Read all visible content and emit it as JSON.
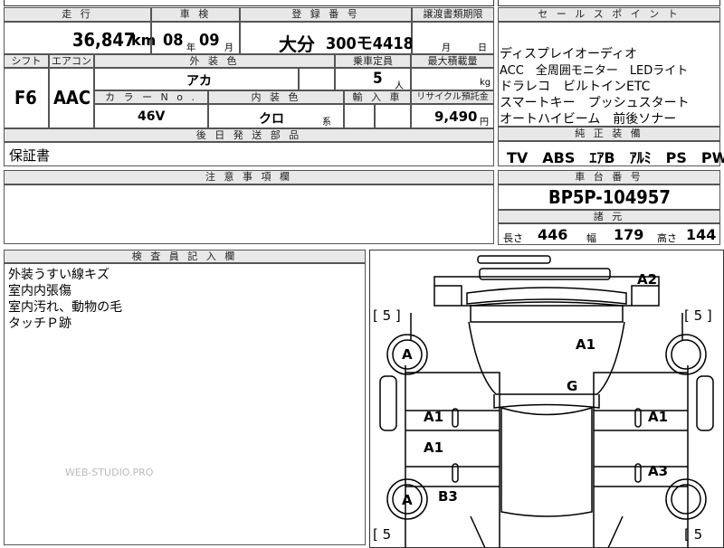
{
  "header": {
    "mileage_label": "走 行",
    "inspection_label": "車 検",
    "registration_label": "登 録 番 号",
    "transfer_label": "譲渡書類期限",
    "selling_points_label": "セ ー ル ス ポ イ ン ト"
  },
  "mileage": {
    "value": "36,847",
    "unit": "km"
  },
  "inspection": {
    "year": "08",
    "year_unit": "年",
    "month": "09",
    "month_unit": "月"
  },
  "registration": {
    "region": "大分",
    "number": "300モ4418"
  },
  "transfer": {
    "month_unit": "月",
    "day_unit": "日"
  },
  "specs": {
    "shift_label": "シフト",
    "shift": "F6",
    "ac_label": "エアコン",
    "ac": "AAC",
    "exterior_label": "外 装 色",
    "exterior": "アカ",
    "seats_label": "乗車定員",
    "seats": "5",
    "seats_unit": "人",
    "load_label": "最大積載量",
    "load_unit": "kg",
    "color_no_label": "カ ラ ー N o .",
    "color_no": "46V",
    "interior_label": "内 装 色",
    "interior": "クロ",
    "interior_unit": "系",
    "import_label": "輸 入 車",
    "recycle_label": "リサイクル預託金",
    "recycle": "9,490",
    "recycle_unit": "円"
  },
  "selling_points": [
    "ディスプレイオーディオ",
    "ACC　全周囲モニター　LEDライト",
    "ドラレコ　ビルトインETC",
    "スマートキー　プッシュスタート",
    "オートハイビーム　前後ソナー"
  ],
  "later_parts": {
    "label": "後 日 発 送 部 品",
    "value": "保証書"
  },
  "equipment": {
    "label": "純 正 装 備",
    "value": "TV　ABS　ｴｱB　ｱﾙﾐ　PS　PW"
  },
  "notes": {
    "label": "注 意 事 項 欄"
  },
  "chassis": {
    "label": "車 台 番 号",
    "value": "BP5P-104957"
  },
  "dimensions": {
    "label": "諸 元",
    "length_label": "長さ",
    "length": "446",
    "width_label": "幅",
    "width": "179",
    "height_label": "高さ",
    "height": "144"
  },
  "inspector": {
    "label": "検 査 員 記 入 欄",
    "lines": [
      "外装うすい線キズ",
      "室内内張傷",
      "室内汚れ、動物の毛",
      "タッチＰ跡"
    ]
  },
  "watermark": "WEB-STUDIO.PRO",
  "diagram_marks": {
    "front": "A2",
    "hood": "A1",
    "roof": "G",
    "left_front_door": "A1",
    "left_rear_door": "A1",
    "right_front_door": "A1",
    "right_rear_door": "A3",
    "left_front_wheel": "A",
    "left_rear_wheel": "A",
    "left_rear_fender": "B3",
    "tire_fl": "[ 5 ]",
    "tire_fr": "[ 5 ]",
    "tire_rl": "[ 5",
    "tire_rr": "[ 5"
  }
}
